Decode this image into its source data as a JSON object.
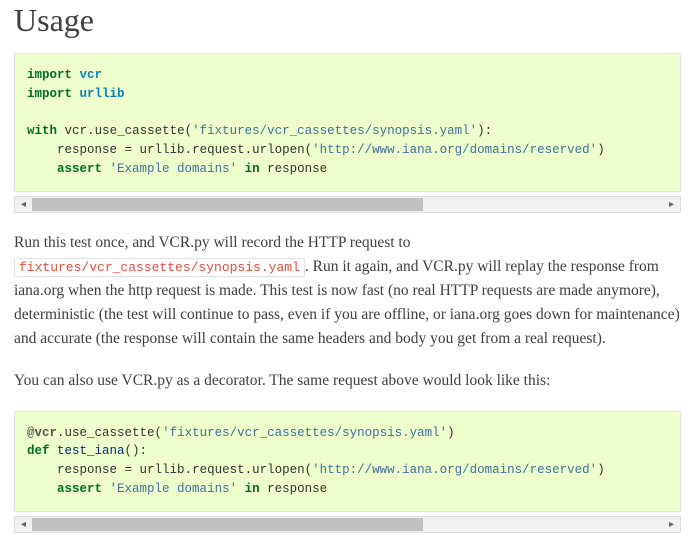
{
  "heading": "Usage",
  "code1": {
    "l1_kw1": "import",
    "l1_mod": "vcr",
    "l2_kw1": "import",
    "l2_mod": "urllib",
    "l4_kw1": "with",
    "l4_n1": "vcr",
    "l4_n2": "use_cassette",
    "l4_s": "'fixtures/vcr_cassettes/synopsis.yaml'",
    "l5_n1": "response",
    "l5_eq": " = ",
    "l5_n2": "urllib",
    "l5_n3": "request",
    "l5_n4": "urlopen",
    "l5_s": "'http://www.iana.org/domains/reserved'",
    "l6_kw": "assert",
    "l6_s": "'Example domains'",
    "l6_ow": "in",
    "l6_n": "response"
  },
  "para1_a": "Run this test once, and VCR.py will record the HTTP request to ",
  "para1_code": "fixtures/vcr_cassettes/synopsis.yaml",
  "para1_b": ". Run it again, and VCR.py will replay the re­sponse from iana.org when the http request is made. This test is now fast (no real HTTP requests are made anymore), deterministic (the test will continue to pass, even if you are offline, or iana.org goes down for maintenance) and accurate (the response will con­tain the same headers and body you get from a real request).",
  "para2": "You can also use VCR.py as a decorator. The same request above would look like this:",
  "code2": {
    "l1_dec": "@vcr",
    "l1_n": "use_cassette",
    "l1_s": "'fixtures/vcr_cassettes/synopsis.yaml'",
    "l2_kw": "def",
    "l2_nf": "test_iana",
    "l3_n1": "response",
    "l3_eq": " = ",
    "l3_n2": "urllib",
    "l3_n3": "request",
    "l3_n4": "urlopen",
    "l3_s": "'http://www.iana.org/domains/reserved'",
    "l4_kw": "assert",
    "l4_s": "'Example domains'",
    "l4_ow": "in",
    "l4_n": "response"
  }
}
